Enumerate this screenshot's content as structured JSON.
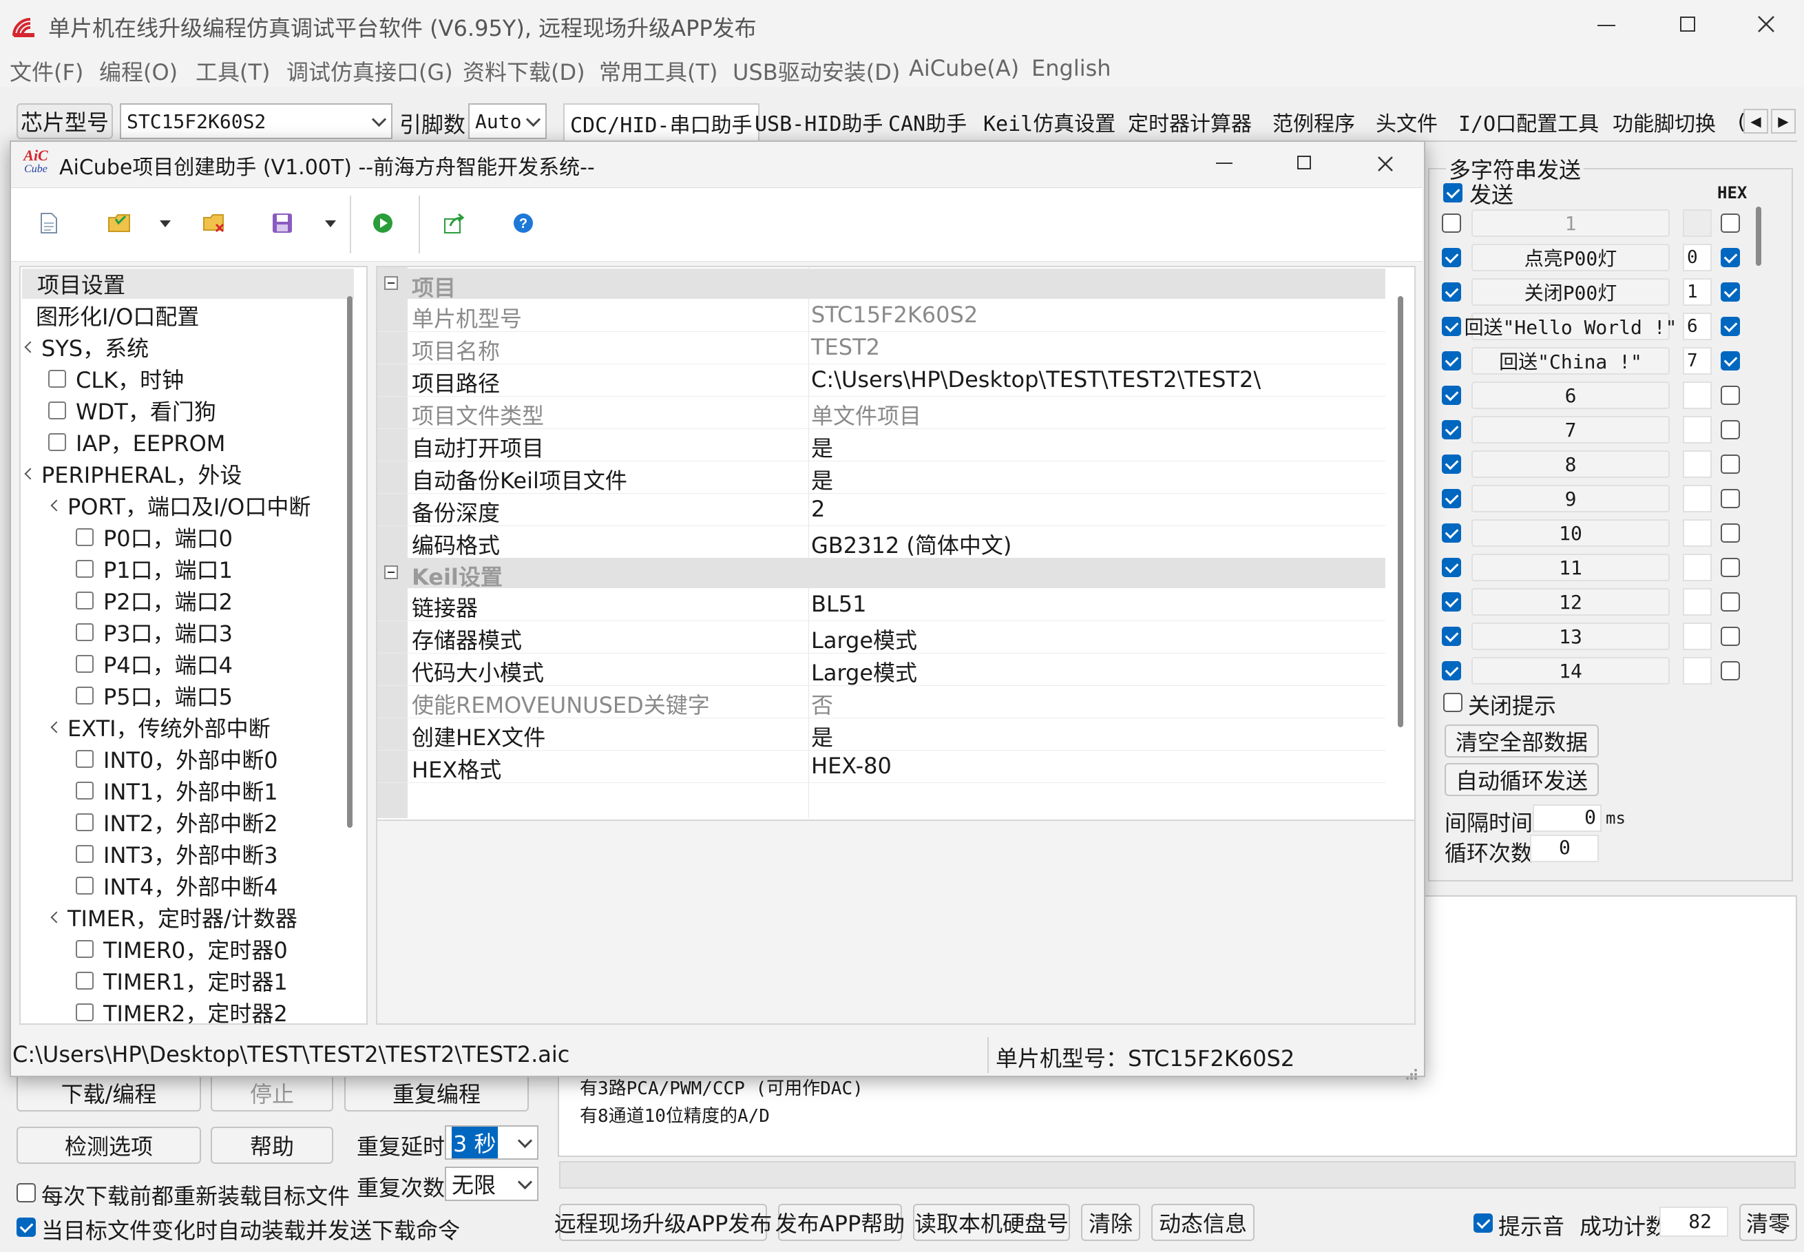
{
  "main_window": {
    "title": "单片机在线升级编程仿真调试平台软件 (V6.95Y), 远程现场升级APP发布",
    "menu": [
      "文件(F)",
      "编程(O)",
      "工具(T)",
      "调试仿真接口(G)",
      "资料下载(D)",
      "常用工具(T)",
      "USB驱动安装(D)",
      "AiCube(A)",
      "English"
    ],
    "chip_label": "芯片型号",
    "chip_value": "STC15F2K60S2",
    "pin_label": "引脚数",
    "pin_value": "Auto",
    "tabs": [
      "CDC/HID-串口助手",
      "USB-HID助手",
      "CAN助手",
      "Keil仿真设置",
      "定时器计算器",
      "范例程序",
      "头文件",
      "I/O口配置工具",
      "功能脚切换",
      "("
    ]
  },
  "multi_send": {
    "group_label": "多字符串发送",
    "send_label": "发送",
    "hex_label": "HEX",
    "rows": [
      {
        "label": "1",
        "index": "",
        "checked": false,
        "hex": false,
        "idx_disabled": true
      },
      {
        "label": "点亮P00灯",
        "index": "0",
        "checked": true,
        "hex": true
      },
      {
        "label": "关闭P00灯",
        "index": "1",
        "checked": true,
        "hex": true
      },
      {
        "label": "回送\"Hello World !\"",
        "index": "6",
        "checked": true,
        "hex": true
      },
      {
        "label": "回送\"China !\"",
        "index": "7",
        "checked": true,
        "hex": true
      },
      {
        "label": "6",
        "index": "",
        "checked": true,
        "hex": false
      },
      {
        "label": "7",
        "index": "",
        "checked": true,
        "hex": false
      },
      {
        "label": "8",
        "index": "",
        "checked": true,
        "hex": false
      },
      {
        "label": "9",
        "index": "",
        "checked": true,
        "hex": false
      },
      {
        "label": "10",
        "index": "",
        "checked": true,
        "hex": false
      },
      {
        "label": "11",
        "index": "",
        "checked": true,
        "hex": false
      },
      {
        "label": "12",
        "index": "",
        "checked": true,
        "hex": false
      },
      {
        "label": "13",
        "index": "",
        "checked": true,
        "hex": false
      },
      {
        "label": "14",
        "index": "",
        "checked": true,
        "hex": false
      }
    ],
    "close_tip_label": "关闭提示",
    "clear_all_label": "清空全部数据",
    "auto_loop_label": "自动循环发送",
    "interval_label": "间隔时间",
    "interval_value": "0",
    "interval_unit": "ms",
    "loop_count_label": "循环次数",
    "loop_count_value": "0"
  },
  "bottom": {
    "download_btn": "下载/编程",
    "stop_btn": "停止",
    "reprogram_btn": "重复编程",
    "check_btn": "检测选项",
    "help_btn": "帮助",
    "repeat_delay_label": "重复延时",
    "repeat_delay_value": "3 秒",
    "repeat_count_label": "重复次数",
    "repeat_count_value": "无限",
    "reload_label": "每次下载前都重新装载目标文件",
    "auto_load_label": "当目标文件变化时自动装载并发送下载命令",
    "info_lines": [
      "有3路PCA/PWM/CCP (可用作DAC)",
      "有8通道10位精度的A/D"
    ],
    "remote_btn": "远程现场升级APP发布",
    "publish_help_btn": "发布APP帮助",
    "read_disk_btn": "读取本机硬盘号",
    "clear_btn": "清除",
    "dynamic_btn": "动态信息",
    "beep_label": "提示音",
    "success_label": "成功计数",
    "success_value": "82",
    "clear_count_btn": "清零"
  },
  "aicube": {
    "logo_top": "AiC",
    "logo_bottom": "Cube",
    "title": "AiCube项目创建助手 (V1.00T) --前海方舟智能开发系统--",
    "tree": [
      {
        "label": "项目设置",
        "level": 0,
        "type": "plain",
        "selected": true
      },
      {
        "label": "图形化I/O口配置",
        "level": 0,
        "type": "plain"
      },
      {
        "label": "SYS，系统",
        "level": 0,
        "type": "expand"
      },
      {
        "label": "CLK，时钟",
        "level": 1,
        "type": "check"
      },
      {
        "label": "WDT，看门狗",
        "level": 1,
        "type": "check"
      },
      {
        "label": "IAP，EEPROM",
        "level": 1,
        "type": "check"
      },
      {
        "label": "PERIPHERAL，外设",
        "level": 0,
        "type": "expand"
      },
      {
        "label": "PORT，端口及I/O口中断",
        "level": 1,
        "type": "expand"
      },
      {
        "label": "P0口，端口0",
        "level": 2,
        "type": "check"
      },
      {
        "label": "P1口，端口1",
        "level": 2,
        "type": "check"
      },
      {
        "label": "P2口，端口2",
        "level": 2,
        "type": "check"
      },
      {
        "label": "P3口，端口3",
        "level": 2,
        "type": "check"
      },
      {
        "label": "P4口，端口4",
        "level": 2,
        "type": "check"
      },
      {
        "label": "P5口，端口5",
        "level": 2,
        "type": "check"
      },
      {
        "label": "EXTI，传统外部中断",
        "level": 1,
        "type": "expand"
      },
      {
        "label": "INT0，外部中断0",
        "level": 2,
        "type": "check"
      },
      {
        "label": "INT1，外部中断1",
        "level": 2,
        "type": "check"
      },
      {
        "label": "INT2，外部中断2",
        "level": 2,
        "type": "check"
      },
      {
        "label": "INT3，外部中断3",
        "level": 2,
        "type": "check"
      },
      {
        "label": "INT4，外部中断4",
        "level": 2,
        "type": "check"
      },
      {
        "label": "TIMER，定时器/计数器",
        "level": 1,
        "type": "expand"
      },
      {
        "label": "TIMER0，定时器0",
        "level": 2,
        "type": "check"
      },
      {
        "label": "TIMER1，定时器1",
        "level": 2,
        "type": "check"
      },
      {
        "label": "TIMER2，定时器2",
        "level": 2,
        "type": "check"
      }
    ],
    "props": [
      {
        "kind": "cat",
        "label": "项目"
      },
      {
        "kind": "row",
        "key": "单片机型号",
        "value": "STC15F2K60S2",
        "disabled": true
      },
      {
        "kind": "row",
        "key": "项目名称",
        "value": "TEST2",
        "disabled": true
      },
      {
        "kind": "row",
        "key": "项目路径",
        "value": "C:\\Users\\HP\\Desktop\\TEST\\TEST2\\TEST2\\"
      },
      {
        "kind": "row",
        "key": "项目文件类型",
        "value": "单文件项目",
        "disabled": true
      },
      {
        "kind": "row",
        "key": "自动打开项目",
        "value": "是"
      },
      {
        "kind": "row",
        "key": "自动备份Keil项目文件",
        "value": "是"
      },
      {
        "kind": "row",
        "key": "备份深度",
        "value": "2"
      },
      {
        "kind": "row",
        "key": "编码格式",
        "value": "GB2312 (简体中文)"
      },
      {
        "kind": "cat",
        "label": "Keil设置"
      },
      {
        "kind": "row",
        "key": "链接器",
        "value": "BL51"
      },
      {
        "kind": "row",
        "key": "存储器模式",
        "value": "Large模式"
      },
      {
        "kind": "row",
        "key": "代码大小模式",
        "value": "Large模式"
      },
      {
        "kind": "row",
        "key": "使能REMOVEUNUSED关键字",
        "value": "否",
        "disabled": true
      },
      {
        "kind": "row",
        "key": "创建HEX文件",
        "value": "是"
      },
      {
        "kind": "row",
        "key": "HEX格式",
        "value": "HEX-80"
      }
    ],
    "status_path": "C:\\Users\\HP\\Desktop\\TEST\\TEST2\\TEST2\\TEST2.aic",
    "status_chip": "单片机型号：STC15F2K60S2"
  },
  "colors": {
    "accent": "#0067c0",
    "run_green": "#2a9d3a",
    "help_blue": "#1e78d8",
    "logo_red": "#d6262f"
  }
}
